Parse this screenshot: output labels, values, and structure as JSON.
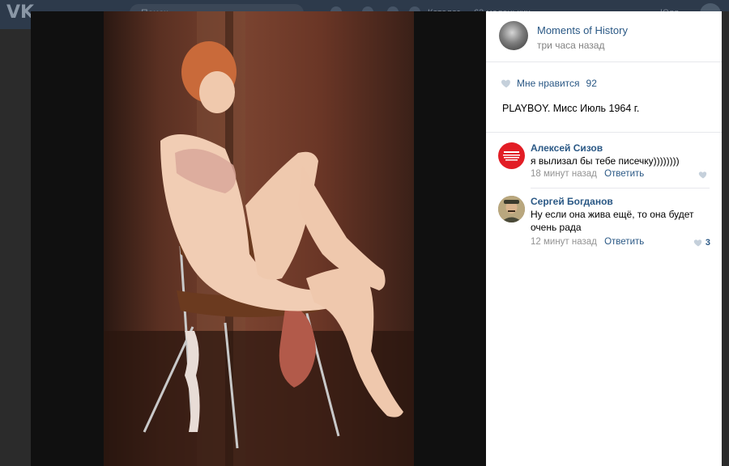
{
  "header": {
    "search_placeholder": "Поиск",
    "nav_text_1": "Каталог",
    "nav_text_2": "63 маленьких",
    "user_label": "Юля"
  },
  "post": {
    "group_name": "Moments of History",
    "time": "три часа назад",
    "likes_label": "Мне нравится",
    "likes_count": "92",
    "text": "PLAYBOY. Мисс Июль 1964 г."
  },
  "comments": [
    {
      "author": "Алексей Сизов",
      "text": "я вылизал бы тебе писечку))))))))",
      "time": "18 минут назад",
      "reply": "Ответить",
      "likes": ""
    },
    {
      "author": "Сергей Богданов",
      "text": "Ну если она жива ещё, то она будет очень рада",
      "time": "12 минут назад",
      "reply": "Ответить",
      "likes": "3"
    }
  ],
  "colors": {
    "link": "#2a5885",
    "header_bg": "#2d3a4b",
    "backdrop": "#101010"
  }
}
